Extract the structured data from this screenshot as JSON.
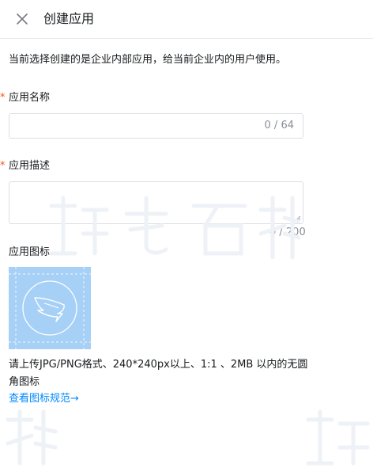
{
  "header": {
    "title": "创建应用",
    "close_icon": "close-icon"
  },
  "notice": "当前选择创建的是企业内部应用，给当前企业内的用户使用。",
  "form": {
    "required_mark": "*",
    "name": {
      "label": "应用名称",
      "value": "",
      "placeholder": "",
      "counter": "0 / 64"
    },
    "description": {
      "label": "应用描述",
      "value": "",
      "placeholder": "",
      "counter": "0 / 200"
    },
    "icon": {
      "label": "应用图标",
      "icon_name": "dingtalk-wing-icon",
      "hint": "请上传JPG/PNG格式、240*240px以上、1:1 、2MB 以内的无圆角图标",
      "link": "查看图标规范→"
    }
  },
  "colors": {
    "accent": "#0089ff",
    "required": "#ff5219",
    "icon_bg": "#a6d0f6",
    "muted": "#8a8e99"
  }
}
